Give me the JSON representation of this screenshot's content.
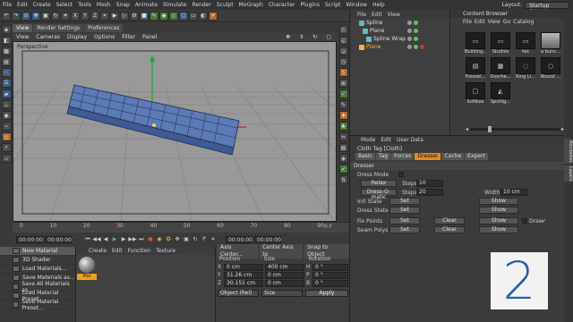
{
  "menubar": {
    "items": [
      "File",
      "Edit",
      "Create",
      "Select",
      "Tools",
      "Mesh",
      "Snap",
      "Animate",
      "Simulate",
      "Render",
      "Sculpt",
      "MoGraph",
      "Character",
      "Plugins",
      "Script",
      "Window",
      "Help"
    ],
    "layout_label": "Layout:",
    "layout_value": "Startup (User)"
  },
  "viewport": {
    "tabs": [
      "View",
      "Render Settings",
      "Preferences"
    ],
    "menu": [
      "View",
      "Cameras",
      "Display",
      "Options",
      "Filter",
      "Panel"
    ],
    "label": "Perspective"
  },
  "timeline": {
    "ticks": [
      "0",
      "10",
      "20",
      "30",
      "40",
      "50",
      "60",
      "70",
      "80",
      "90"
    ],
    "end_frame": "0 F",
    "start_field": "00:00:00",
    "current_field": "00:00:00",
    "end_field": "00:00:00",
    "max_field": "00:00:00"
  },
  "material_manager": {
    "items": [
      "New Material",
      "3D Shader",
      "Load Materials...",
      "Save Materials as...",
      "Save All Materials as...",
      "Load Material Preset",
      "Save Material Preset..."
    ],
    "menu": [
      "Create",
      "Edit",
      "Function",
      "Texture"
    ],
    "material_name": "Mat"
  },
  "coordinates": {
    "tabs": [
      "Axis Center...",
      "Center Axis to",
      "Snap to Object"
    ],
    "headers": [
      "Position",
      "Size",
      "Rotation"
    ],
    "rows": [
      {
        "axis": "X",
        "pos": "0 cm",
        "size": "400 cm",
        "rot_axis": "H",
        "rot": "0 °"
      },
      {
        "axis": "Y",
        "pos": "31.26 cm",
        "size": "0 cm",
        "rot_axis": "P",
        "rot": "0 °"
      },
      {
        "axis": "Z",
        "pos": "30.151 cm",
        "size": "0 cm",
        "rot_axis": "B",
        "rot": "0 °"
      }
    ],
    "mode": "Object (Rel)",
    "size_mode": "Size",
    "apply": "Apply"
  },
  "object_manager": {
    "menu": [
      "File",
      "Edit",
      "View"
    ],
    "objects": [
      {
        "name": "Spline",
        "color": "#6bb"
      },
      {
        "name": "Plane",
        "color": "#6bb"
      },
      {
        "name": "Spline Wrap",
        "color": "#6bb"
      },
      {
        "name": "Plane",
        "color": "#f5b042"
      }
    ]
  },
  "content_browser": {
    "title": "Content Browser",
    "menu": [
      "File",
      "Edit",
      "View",
      "Go",
      "Catalog"
    ],
    "items": [
      "Building...",
      "Studios",
      "tex",
      "a bunc...",
      "Fresnel...",
      "Overhe...",
      "Ring Li...",
      "Round ...",
      "Softbox",
      "Spotlig..."
    ]
  },
  "attributes": {
    "menu": [
      "Mode",
      "Edit",
      "User Data"
    ],
    "title": "Cloth Tag [Cloth]",
    "tabs": [
      "Basic",
      "Tag",
      "Forces",
      "Dresser",
      "Cache",
      "Expert"
    ],
    "active_tab": "Dresser",
    "section": "Dresser",
    "dress_mode": "Dress Mode",
    "relax_btn": "Relax",
    "steps_label": "Steps",
    "steps_relax": "10",
    "dress_o_matic_btn": "Dress-O-matic",
    "steps_dress": "20",
    "width_label": "Width",
    "width_value": "10 cm",
    "init_state": "Init State",
    "dress_state": "Dress State",
    "fix_points": "Fix Points",
    "seam_polys": "Seam Polys",
    "set": "Set",
    "show": "Show",
    "clear": "Clear",
    "draw": "Draw"
  },
  "side_tabs": [
    "Attributes",
    "Layers"
  ],
  "watermark": "2"
}
